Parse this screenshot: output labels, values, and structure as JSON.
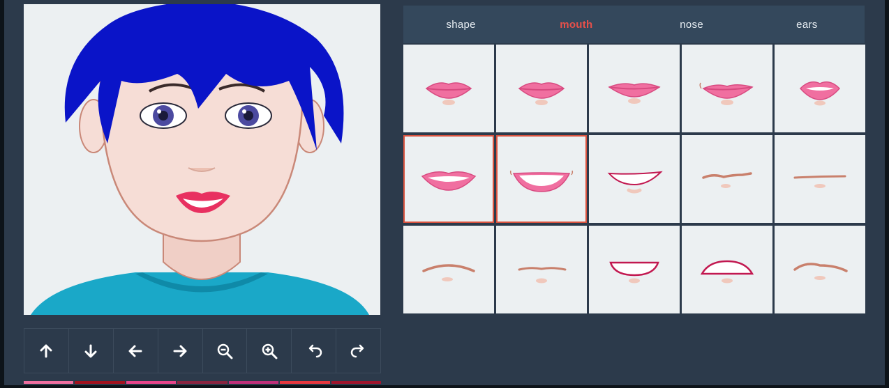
{
  "tabs": [
    {
      "id": "shape",
      "label": "shape"
    },
    {
      "id": "mouth",
      "label": "mouth"
    },
    {
      "id": "nose",
      "label": "nose"
    },
    {
      "id": "ears",
      "label": "ears"
    }
  ],
  "active_tab": "mouth",
  "toolbar": [
    {
      "name": "move-up-button",
      "icon": "arrow-up-icon"
    },
    {
      "name": "move-down-button",
      "icon": "arrow-down-icon"
    },
    {
      "name": "move-left-button",
      "icon": "arrow-left-icon"
    },
    {
      "name": "move-right-button",
      "icon": "arrow-right-icon"
    },
    {
      "name": "zoom-out-button",
      "icon": "zoom-out-icon"
    },
    {
      "name": "zoom-in-button",
      "icon": "zoom-in-icon"
    },
    {
      "name": "undo-button",
      "icon": "undo-icon"
    },
    {
      "name": "redo-button",
      "icon": "redo-icon"
    }
  ],
  "swatch_colors": [
    "#f06fa0",
    "#a3121e",
    "#e8448a",
    "#8a2440",
    "#c0307a",
    "#e8383f",
    "#a0142c"
  ],
  "mouth_options": [
    {
      "style": "lips-closed"
    },
    {
      "style": "lips-closed"
    },
    {
      "style": "lips-wide"
    },
    {
      "style": "lips-smirk"
    },
    {
      "style": "lips-open-small"
    },
    {
      "style": "lips-open"
    },
    {
      "style": "lips-teeth-smile"
    },
    {
      "style": "outline-smile"
    },
    {
      "style": "line-wavy"
    },
    {
      "style": "line-thin"
    },
    {
      "style": "line-arc"
    },
    {
      "style": "line-flat"
    },
    {
      "style": "outline-open-down"
    },
    {
      "style": "outline-open-up"
    },
    {
      "style": "line-smirk"
    }
  ],
  "selected_mouths": [
    5,
    6
  ],
  "colors": {
    "hair": "#0a14c8",
    "shirt": "#1aa8c8",
    "lips": "#f06fa0",
    "skin": "#f6ddd6",
    "accent": "#e8504a"
  }
}
